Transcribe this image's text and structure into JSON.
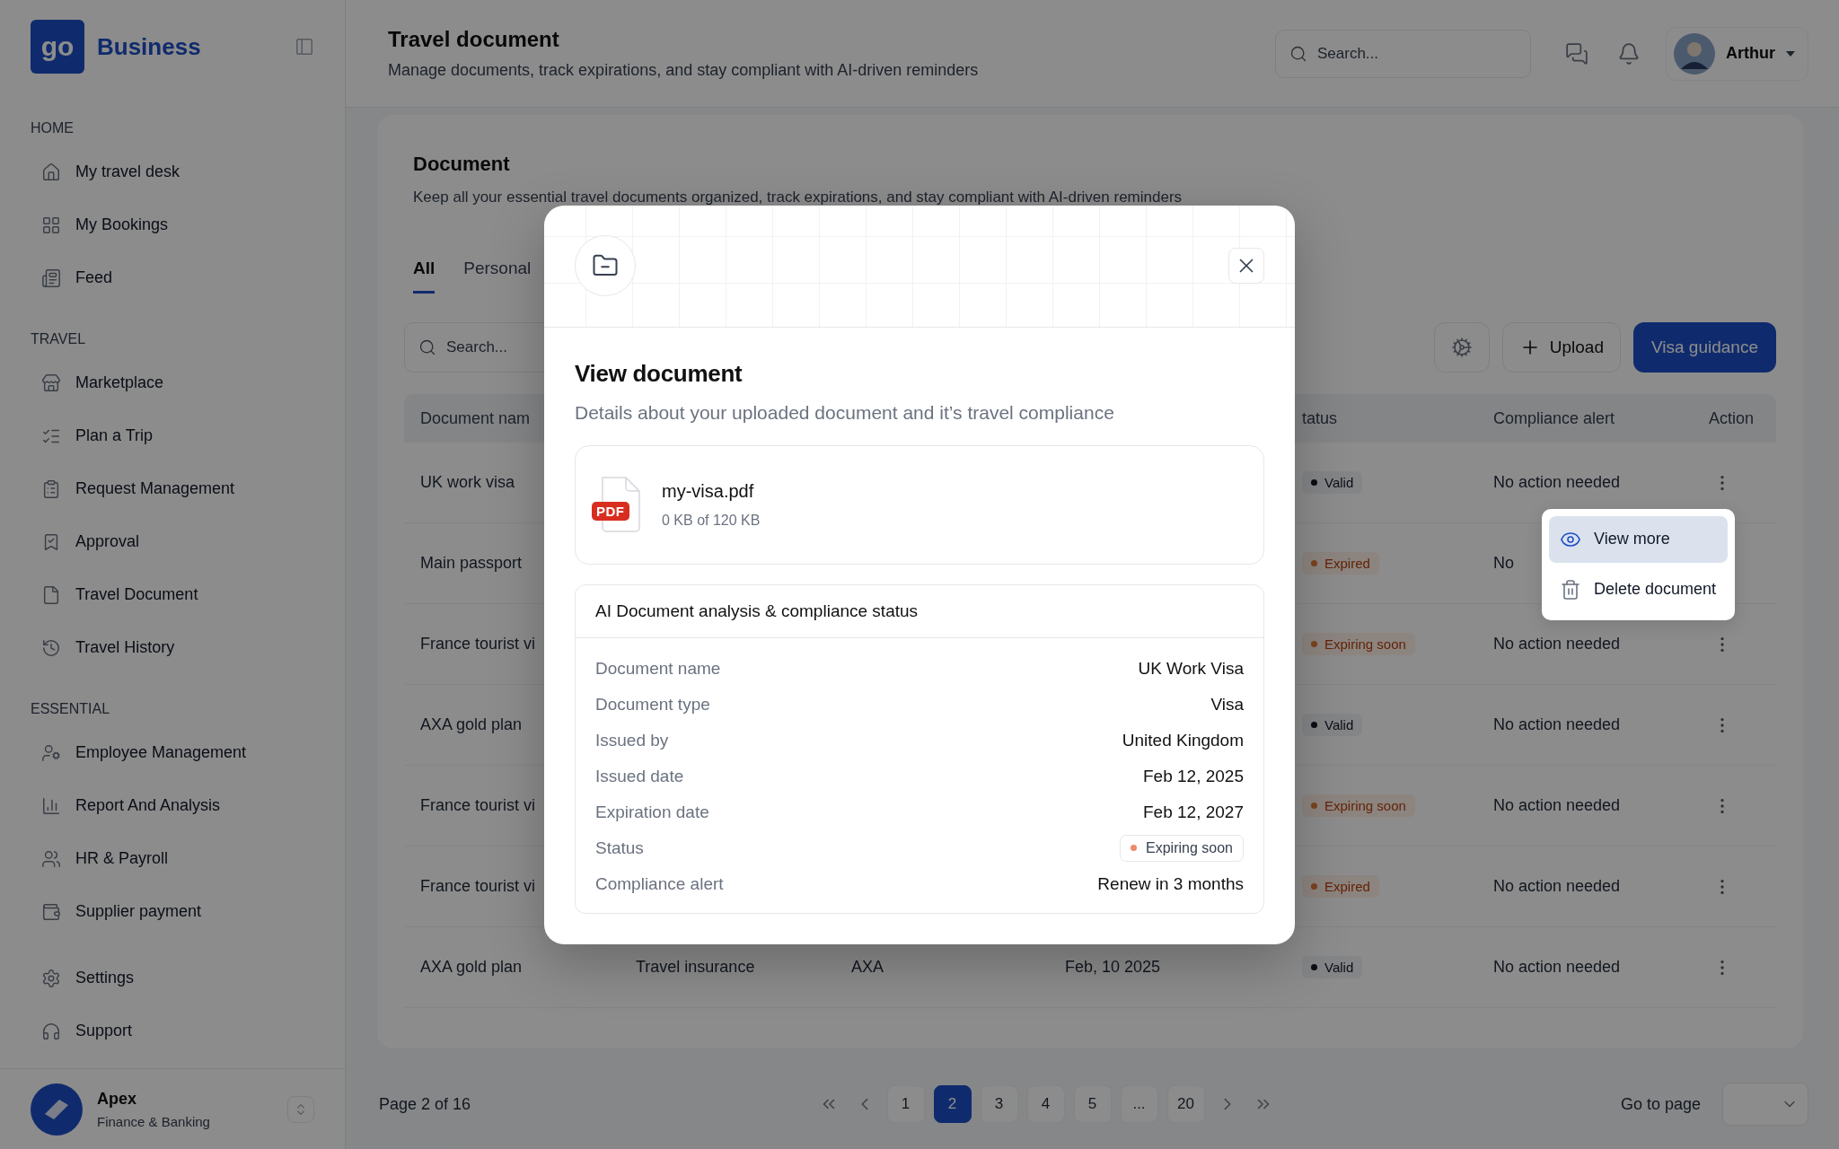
{
  "sidebar": {
    "logo_mark": "go",
    "brand": "Business",
    "sections": [
      {
        "title": "HOME",
        "items": [
          {
            "label": "My travel desk"
          },
          {
            "label": "My Bookings"
          },
          {
            "label": "Feed"
          }
        ]
      },
      {
        "title": "TRAVEL",
        "items": [
          {
            "label": "Marketplace"
          },
          {
            "label": "Plan a Trip"
          },
          {
            "label": "Request Management"
          },
          {
            "label": "Approval"
          },
          {
            "label": "Travel Document"
          },
          {
            "label": "Travel History"
          }
        ]
      },
      {
        "title": "ESSENTIAL",
        "items": [
          {
            "label": "Employee Management"
          },
          {
            "label": "Report And Analysis"
          },
          {
            "label": "HR & Payroll"
          },
          {
            "label": "Supplier payment"
          }
        ]
      }
    ],
    "footer_items": [
      {
        "label": "Settings"
      },
      {
        "label": "Support"
      }
    ],
    "account": {
      "name": "Apex",
      "subtitle": "Finance & Banking"
    }
  },
  "header": {
    "title": "Travel document",
    "subtitle": "Manage documents, track expirations, and stay compliant with AI-driven reminders",
    "search_placeholder": "Search...",
    "user": "Arthur"
  },
  "content": {
    "title": "Document",
    "description": "Keep all your essential travel documents organized, track expirations, and stay compliant with AI-driven reminders",
    "tabs": [
      {
        "label": "All",
        "selected": true
      },
      {
        "label": "Personal",
        "selected": false
      }
    ],
    "search_placeholder": "Search...",
    "upload": "Upload",
    "guidance": "Visa guidance"
  },
  "table": {
    "headers": {
      "document_name": "Document nam",
      "status": "tatus",
      "compliance_alert": "Compliance alert",
      "action": "Action"
    },
    "rows": [
      {
        "document_name": "UK work visa",
        "status": {
          "label": "Valid",
          "kind": "valid"
        },
        "compliance_alert": "No action needed",
        "menu": [
          {
            "label": "View more",
            "selected": true
          },
          {
            "label": "Delete document",
            "selected": false
          }
        ]
      },
      {
        "document_name": "Main passport",
        "status": {
          "label": "Expired",
          "kind": "expired"
        },
        "compliance_alert": "No"
      },
      {
        "document_name": "France tourist vi",
        "status": {
          "label": "Expiring soon",
          "kind": "expiring"
        },
        "compliance_alert": "No action needed"
      },
      {
        "document_name": "AXA gold plan",
        "status": {
          "label": "Valid",
          "kind": "valid"
        },
        "compliance_alert": "No action needed"
      },
      {
        "document_name": "France tourist vi",
        "status": {
          "label": "Expiring soon",
          "kind": "expiring"
        },
        "compliance_alert": "No action needed"
      },
      {
        "document_name": "France tourist vi",
        "status": {
          "label": "Expired",
          "kind": "expired"
        },
        "compliance_alert": "No action needed"
      },
      {
        "document_name": "AXA gold plan",
        "column_2": "Travel insurance",
        "column_3": "AXA",
        "column_4": "Feb, 10 2025",
        "status": {
          "label": "Valid",
          "kind": "valid"
        },
        "compliance_alert": "No action needed"
      }
    ]
  },
  "pagination": {
    "summary": "Page 2 of 16",
    "pages": [
      {
        "label": "1",
        "selected": false
      },
      {
        "label": "2",
        "selected": true
      },
      {
        "label": "3",
        "selected": false
      },
      {
        "label": "4",
        "selected": false
      },
      {
        "label": "5",
        "selected": false
      },
      {
        "label": "...",
        "selected": false
      },
      {
        "label": "20",
        "selected": false
      }
    ],
    "go_to": "Go to page"
  },
  "modal": {
    "title": "View document",
    "subtitle": "Details about your uploaded document and it’s travel compliance",
    "file": {
      "badge": "PDF",
      "name": "my-visa.pdf",
      "size": "0 KB of 120 KB"
    },
    "analysis": {
      "title": "AI Document analysis & compliance status",
      "rows": [
        {
          "label": "Document name",
          "value": "UK Work Visa",
          "kind": "text"
        },
        {
          "label": "Document type",
          "value": "Visa",
          "kind": "text"
        },
        {
          "label": "Issued by",
          "value": "United Kingdom",
          "kind": "text"
        },
        {
          "label": "Issued date",
          "value": "Feb 12, 2025",
          "kind": "text"
        },
        {
          "label": "Expiration date",
          "value": "Feb 12, 2027",
          "kind": "text"
        },
        {
          "label": "Status",
          "value": "Expiring soon",
          "kind": "badge"
        },
        {
          "label": "Compliance alert",
          "value": "Renew in 3 months",
          "kind": "text"
        }
      ]
    }
  }
}
